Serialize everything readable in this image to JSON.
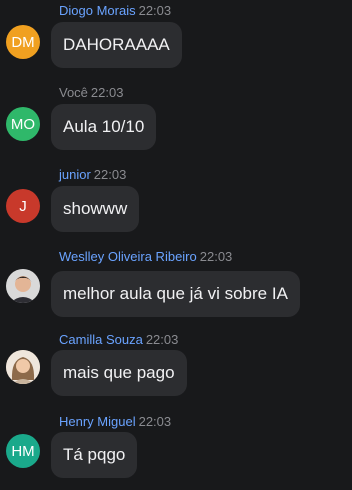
{
  "messages": [
    {
      "author": "Diogo Morais",
      "time": "22:03",
      "text": "DAHORAAAA",
      "initials": "DM",
      "avatar_color": "#f0a020"
    },
    {
      "author": "Você",
      "time": "22:03",
      "text": "Aula 10/10",
      "initials": "MO",
      "avatar_color": "#2fb86a"
    },
    {
      "author": "junior",
      "time": "22:03",
      "text": "showww",
      "initials": "J",
      "avatar_color": "#c8392b"
    },
    {
      "author": "Weslley Oliveira Ribeiro",
      "time": "22:03",
      "text": "melhor aula que já vi sobre IA"
    },
    {
      "author": "Camilla Souza",
      "time": "22:03",
      "text": "mais que pago"
    },
    {
      "author": "Henry Miguel",
      "time": "22:03",
      "text": "Tá pqgo",
      "initials": "HM",
      "avatar_color": "#1aa98b"
    }
  ]
}
